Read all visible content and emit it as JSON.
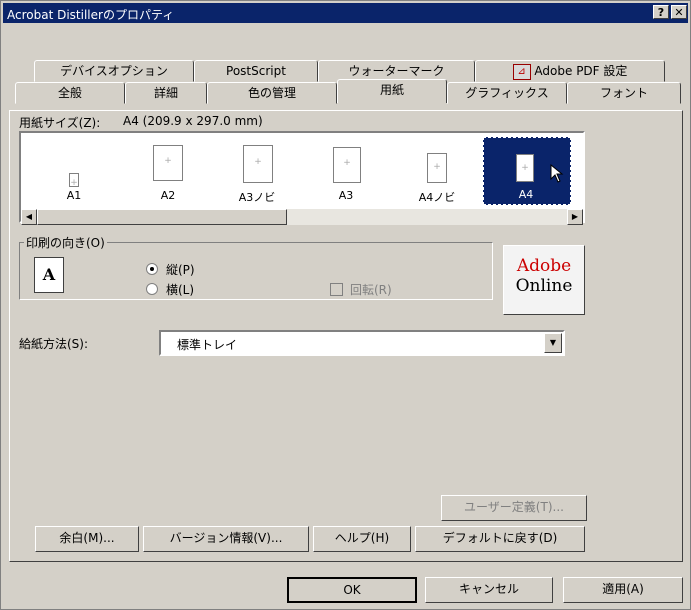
{
  "window": {
    "title": "Acrobat Distillerのプロパティ",
    "help_btn": "?",
    "close_btn": "✕"
  },
  "tabs_row1": [
    "デバイスオプション",
    "PostScript",
    "ウォーターマーク",
    "Adobe PDF 設定"
  ],
  "tabs_row2": [
    "全般",
    "詳細",
    "色の管理",
    "用紙",
    "グラフィックス",
    "フォント"
  ],
  "paper": {
    "size_label": "用紙サイズ(Z):",
    "size_value": "A4 (209.9 x 297.0 mm)",
    "items": [
      "A1",
      "A2",
      "A3ノビ",
      "A3",
      "A4ノビ",
      "A4"
    ]
  },
  "orientation": {
    "legend": "印刷の向き(O)",
    "portrait": "縦(P)",
    "landscape": "横(L)",
    "rotate": "回転(R)",
    "page_letter": "A"
  },
  "adobe_online": {
    "line1": "Adobe",
    "line2": "Online"
  },
  "feed": {
    "label": "給紙方法(S):",
    "value": "標準トレイ"
  },
  "buttons": {
    "user_defined": "ユーザー定義(T)...",
    "margin": "余白(M)...",
    "version": "バージョン情報(V)...",
    "help": "ヘルプ(H)",
    "default": "デフォルトに戻す(D)",
    "ok": "OK",
    "cancel": "キャンセル",
    "apply": "適用(A)"
  },
  "icons": {
    "pdf": "adobe-pdf-icon",
    "portrait": "portrait-page-icon"
  },
  "colors": {
    "titlebar": "#0a246a",
    "selection": "#0a246a",
    "adobe_red": "#cc0000"
  }
}
